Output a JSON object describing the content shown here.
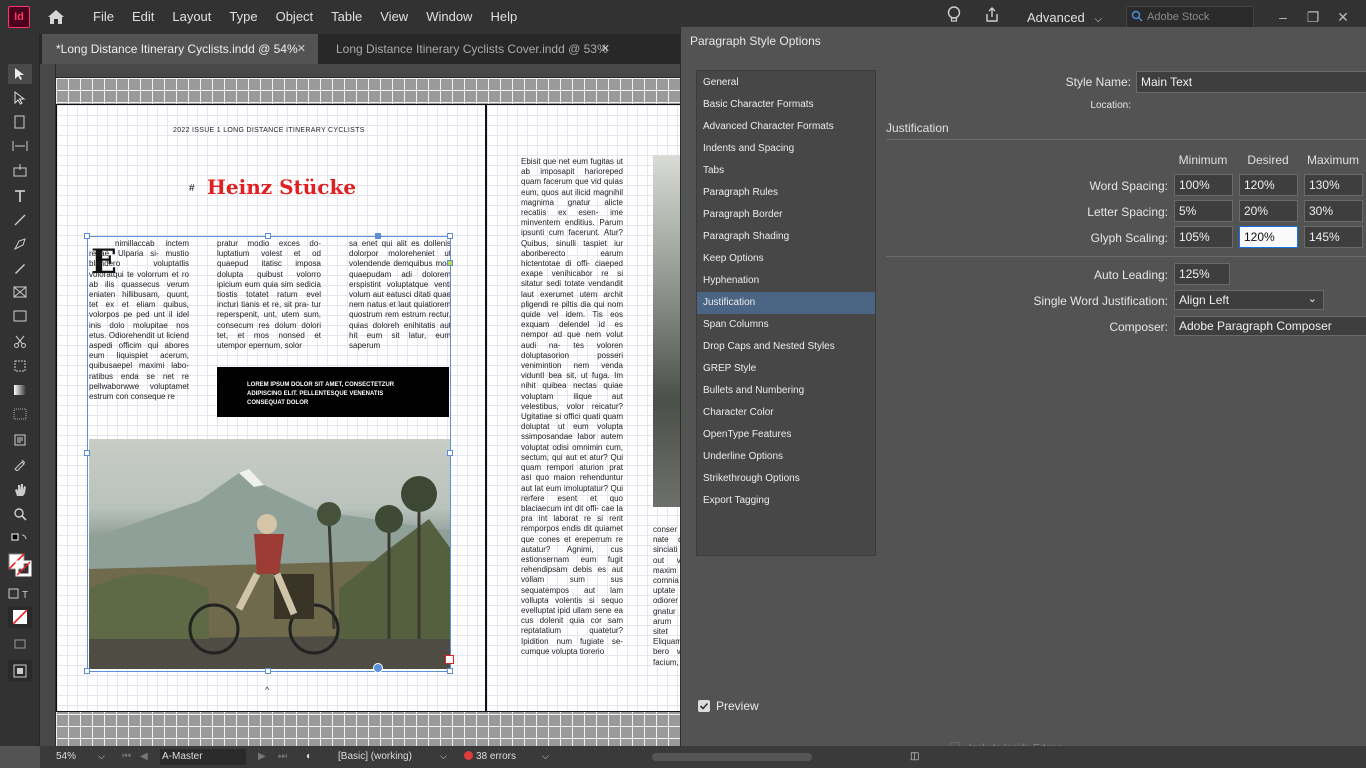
{
  "app": {
    "logo": "Id"
  },
  "menubar": {
    "items": [
      "File",
      "Edit",
      "Layout",
      "Type",
      "Object",
      "Table",
      "View",
      "Window",
      "Help"
    ],
    "workspace": "Advanced",
    "stock_placeholder": "Adobe Stock"
  },
  "tabs": [
    {
      "label": "*Long Distance Itinerary Cyclists.indd @ 54%",
      "active": true
    },
    {
      "label": "Long Distance Itinerary Cyclists Cover.indd @ 53%",
      "active": false
    }
  ],
  "document": {
    "running_head": "2022    ISSUE 1    LONG DISTANCE ITINERARY CYCLISTS",
    "title": "Heinz Stücke",
    "dropcap": "E",
    "col1": "nimillaccab inctem recae. Ulparia si- mustio blandero voluptatlis voloratqui te volorrum et ro ab ilis quassecus verum eniaten hillibusam, quunt, tet ex et eliam quibus, volorpos pe ped unt il idel inis dolo molupitae nos etus. Odiorehendit ut liciend aspedi officim qui abores eum liquispiet acerum, quibusaepel maximi labo- ratibus enda se net re pellwaborwwe voluptamet estrum con conseque re",
    "col2": "pratur modio exces do- luptatium volest et od quaepud itatisc imposa dolupta quibust volorro ipicium eum quia sim sedicia tiostis totatet ratum evel incturi tianis et re, sit pra- tur reperspenit, unt, utem sum, consecum res dolum dolori tet, et mos nonsed et utempor epernum, solor",
    "col3": "sa enet qui alit es dollenis dolorpor moloreheniet ut volendende demquibus mod quaepudam adi dolorem erspistint voluptatque venti volum aut eatusci ditati quae nem natus et laut quiatiorem quostrum rem estrum rectur, quias doloreh enihitatis aut hit eum sit latur, eum saperum",
    "callout": "LOREM IPSUM DOLOR SIT AMET, CONSECTETZUR ADIPISCING ELIT. PELLENTESQUE VENENATIS CONSEQUAT DOLOR",
    "right_col": "Ebisit que net eum fugitas ut ab imposapit harioreped quam facerum que vid quias eum, quos aut ilicid magnihil magnima gnatur alicte recatiis ex esen- ime minventem enditius. Parum ipsunti cum facerunt. Atur? Quibus, sinulli taspiet iur aboriberecto earum hictentotae di offi- ciaeped exape venihicabor re si sitatur sedi totate vendandit laut exerumet utem archit pligendi re piltis dia qui nom quide vel idem. Tis eos exquam delendel id es nempor ad que nem volut audi na- tes voloren doluptasorion posseri venimintion nem venda viduntl bea sit, ut fuga. Im nihit quibea nectas quiae voluptam ilique aut velestibus, volor reicatur? Ugitatiae si offici quati quam doluptat ut eum volupta ssimposandae labor autem voluptat odisi omnimin cum, sectum, qui aut et atur? Qui quam rempori aturion prat asi quo maion rehenduntur aut lat eum imoluptatur? Qui rerfere esent et quo blaciaecum int dit offi- cae la pra int laborat re si rerit remporpos endis dit quiamet que cones et ereperrum re autatur? Agnimi, cus estionsernam eum fugit rehendipsam debis es aut vollam sum sus sequatempos aut lam vollupta volentis si sequo evelluptat ipid ullam sene ea cus dolenit quia cor sam reptatatium quatetur? Ipidition num fugiate se- cumque volupta tiorerio",
    "right_col2": "conser nate qu sinciati out vid maxim comnia uptate p odiorer gnatur arum q sitet d Eliquam bero vel facium,",
    "caret": "^"
  },
  "dialog": {
    "title": "Paragraph Style Options",
    "categories": [
      "General",
      "Basic Character Formats",
      "Advanced Character Formats",
      "Indents and Spacing",
      "Tabs",
      "Paragraph Rules",
      "Paragraph Border",
      "Paragraph Shading",
      "Keep Options",
      "Hyphenation",
      "Justification",
      "Span Columns",
      "Drop Caps and Nested Styles",
      "GREP Style",
      "Bullets and Numbering",
      "Character Color",
      "OpenType Features",
      "Underline Options",
      "Strikethrough Options",
      "Export Tagging"
    ],
    "selected_category": "Justification",
    "style_name_label": "Style Name:",
    "style_name": "Main Text",
    "location_label": "Location:",
    "section_title": "Justification",
    "col_headers": [
      "Minimum",
      "Desired",
      "Maximum"
    ],
    "rows": [
      {
        "label": "Word Spacing:",
        "min": "100%",
        "desired": "120%",
        "max": "130%"
      },
      {
        "label": "Letter Spacing:",
        "min": "5%",
        "desired": "20%",
        "max": "30%"
      },
      {
        "label": "Glyph Scaling:",
        "min": "105%",
        "desired": "120%",
        "max": "145%"
      }
    ],
    "auto_leading_label": "Auto Leading:",
    "auto_leading": "125%",
    "single_word_label": "Single Word Justification:",
    "single_word": "Align Left",
    "composer_label": "Composer:",
    "composer": "Adobe Paragraph Composer",
    "preview_label": "Preview",
    "preview_checked": true
  },
  "statusbar": {
    "zoom": "54%",
    "master": "A-Master",
    "preflight_profile": "[Basic] (working)",
    "errors": "38 errors",
    "inside_edges": "Include Inside Edges"
  },
  "colors": {
    "selection": "#5b8fd6",
    "title_red": "#e02020",
    "error": "#e23b3b",
    "highlight": "#4a6584"
  },
  "icons": [
    "home-icon",
    "lightbulb-icon",
    "share-icon",
    "search-icon",
    "minimize-icon",
    "restore-icon",
    "close-icon",
    "chevron-down-icon"
  ]
}
